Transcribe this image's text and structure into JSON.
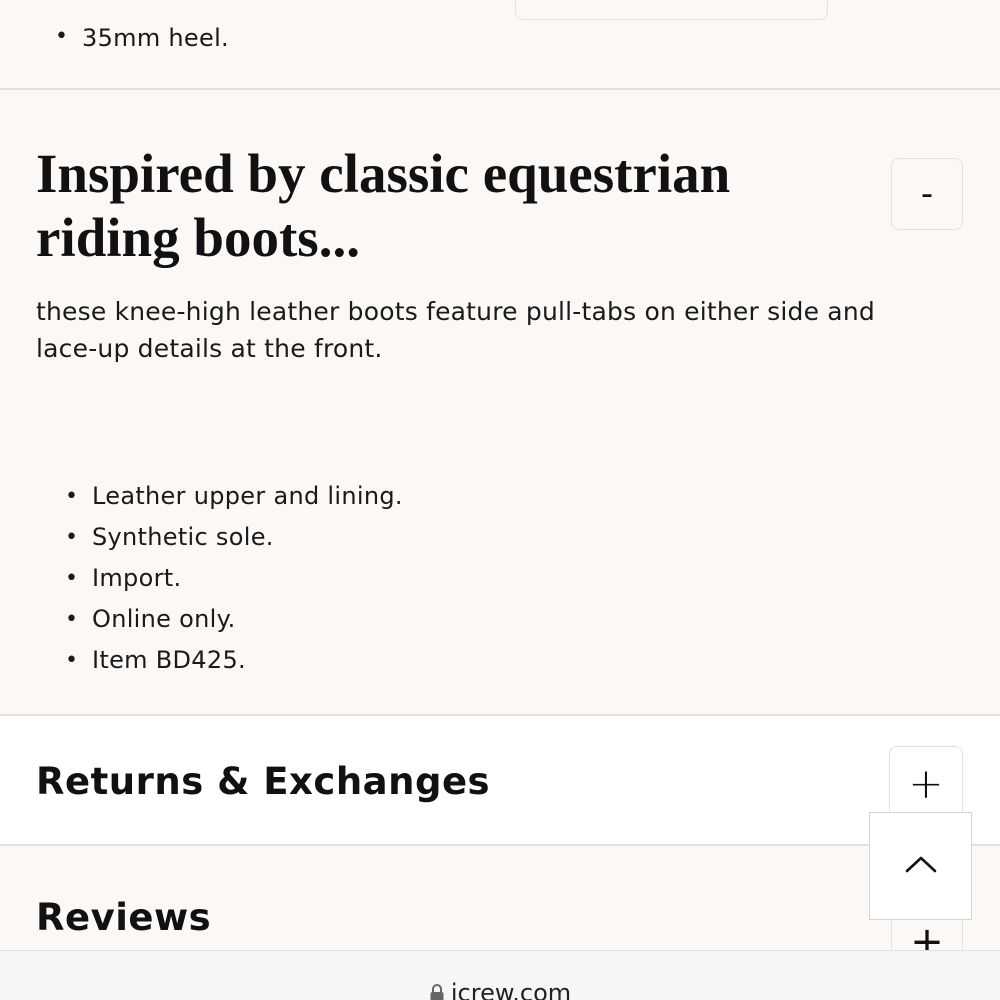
{
  "details": {
    "top_items": [
      "35mm heel."
    ]
  },
  "description": {
    "heading": "Inspired by classic equestrian riding boots...",
    "toggle_symbol": "-",
    "body": "these knee-high leather boots feature pull-tabs on either side and lace-up details at the front.",
    "items": [
      "Leather upper and lining.",
      "Synthetic sole.",
      "Import.",
      "Online only.",
      "Item BD425."
    ]
  },
  "returns": {
    "title": "Returns & Exchanges",
    "toggle_symbol": "+"
  },
  "reviews": {
    "title": "Reviews",
    "toggle_symbol": "+"
  },
  "back_to_top": {
    "icon": "chevron-up-icon"
  },
  "browser": {
    "url": "jcrew.com",
    "icon": "lock-icon"
  }
}
